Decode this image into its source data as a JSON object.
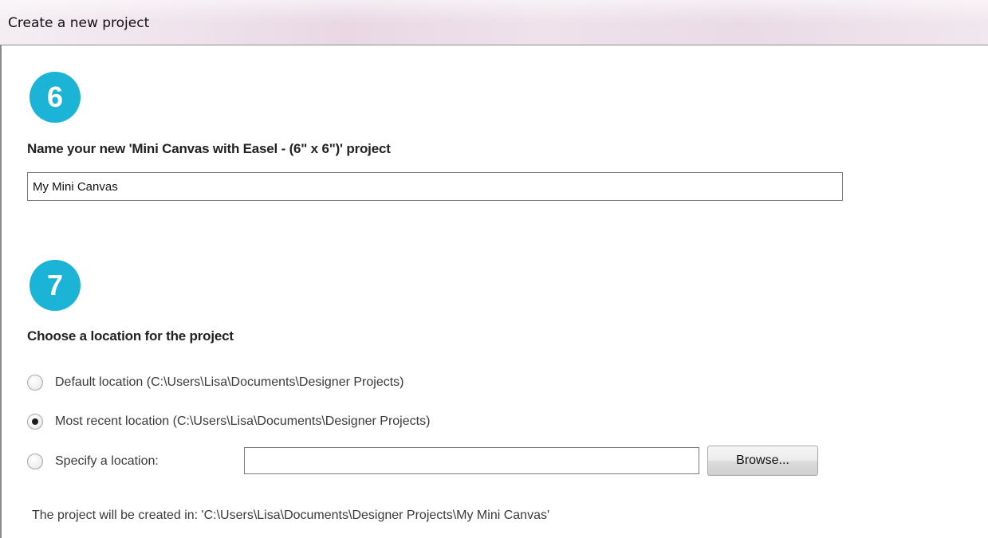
{
  "window": {
    "title": "Create a new project"
  },
  "step_name": {
    "number": "6",
    "heading": "Name your new 'Mini Canvas with Easel - (6\" x 6\")' project",
    "input_value": "My Mini Canvas"
  },
  "step_location": {
    "number": "7",
    "heading": "Choose a location for the project",
    "options": [
      {
        "label": "Default location (C:\\Users\\Lisa\\Documents\\Designer Projects)",
        "checked": false
      },
      {
        "label": "Most recent location (C:\\Users\\Lisa\\Documents\\Designer Projects)",
        "checked": true
      },
      {
        "label": "Specify a location:",
        "checked": false
      }
    ],
    "specify_input_value": "",
    "browse_label": "Browse..."
  },
  "footer": {
    "created_in": "The project will be created in: 'C:\\Users\\Lisa\\Documents\\Designer Projects\\My Mini Canvas'"
  },
  "colors": {
    "step_badge": "#1bb3d6"
  }
}
